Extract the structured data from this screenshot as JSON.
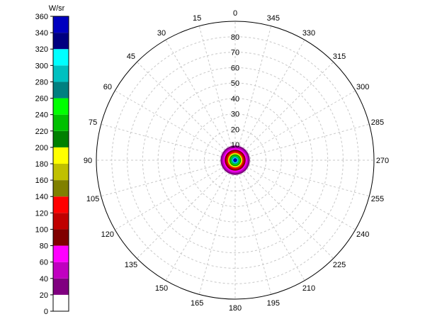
{
  "chart_data": {
    "type": "polar-heatmap",
    "colorbar": {
      "unit": "W/sr",
      "ticks": [
        0,
        20,
        40,
        60,
        80,
        100,
        120,
        140,
        160,
        180,
        200,
        220,
        240,
        260,
        280,
        300,
        320,
        340,
        360
      ],
      "bins": [
        {
          "min": 0,
          "max": 20,
          "color": "#ffffff"
        },
        {
          "min": 20,
          "max": 40,
          "color": "#800080"
        },
        {
          "min": 40,
          "max": 60,
          "color": "#c000c0"
        },
        {
          "min": 60,
          "max": 80,
          "color": "#ff00ff"
        },
        {
          "min": 80,
          "max": 100,
          "color": "#800000"
        },
        {
          "min": 100,
          "max": 120,
          "color": "#c00000"
        },
        {
          "min": 120,
          "max": 140,
          "color": "#ff0000"
        },
        {
          "min": 140,
          "max": 160,
          "color": "#808000"
        },
        {
          "min": 160,
          "max": 180,
          "color": "#c0c000"
        },
        {
          "min": 180,
          "max": 200,
          "color": "#ffff00"
        },
        {
          "min": 200,
          "max": 220,
          "color": "#008000"
        },
        {
          "min": 220,
          "max": 240,
          "color": "#00c000"
        },
        {
          "min": 240,
          "max": 260,
          "color": "#00ff00"
        },
        {
          "min": 260,
          "max": 280,
          "color": "#008080"
        },
        {
          "min": 280,
          "max": 300,
          "color": "#00c0c0"
        },
        {
          "min": 300,
          "max": 320,
          "color": "#00ffff"
        },
        {
          "min": 320,
          "max": 340,
          "color": "#000080"
        },
        {
          "min": 340,
          "max": 360,
          "color": "#0000c0"
        }
      ]
    },
    "polar": {
      "angle_ticks": [
        0,
        15,
        30,
        45,
        60,
        75,
        90,
        105,
        120,
        135,
        150,
        165,
        180,
        195,
        210,
        225,
        240,
        255,
        270,
        285,
        300,
        315,
        330,
        345
      ],
      "angle_direction": "counterclockwise",
      "zero_at": "top",
      "radial_ticks": [
        10,
        20,
        30,
        40,
        50,
        60,
        70,
        80
      ],
      "radial_max": 90,
      "grid": true
    },
    "intensity_rings": [
      {
        "outer_theta": 9.5,
        "value": 30
      },
      {
        "outer_theta": 8.5,
        "value": 50
      },
      {
        "outer_theta": 7.6,
        "value": 70
      },
      {
        "outer_theta": 6.8,
        "value": 90
      },
      {
        "outer_theta": 6.0,
        "value": 110
      },
      {
        "outer_theta": 5.4,
        "value": 130
      },
      {
        "outer_theta": 4.8,
        "value": 170
      },
      {
        "outer_theta": 4.3,
        "value": 190
      },
      {
        "outer_theta": 3.8,
        "value": 210
      },
      {
        "outer_theta": 3.3,
        "value": 230
      },
      {
        "outer_theta": 2.9,
        "value": 250
      },
      {
        "outer_theta": 2.5,
        "value": 270
      },
      {
        "outer_theta": 2.1,
        "value": 290
      },
      {
        "outer_theta": 1.7,
        "value": 310
      },
      {
        "outer_theta": 1.3,
        "value": 330
      },
      {
        "outer_theta": 0.9,
        "value": 350
      }
    ]
  }
}
